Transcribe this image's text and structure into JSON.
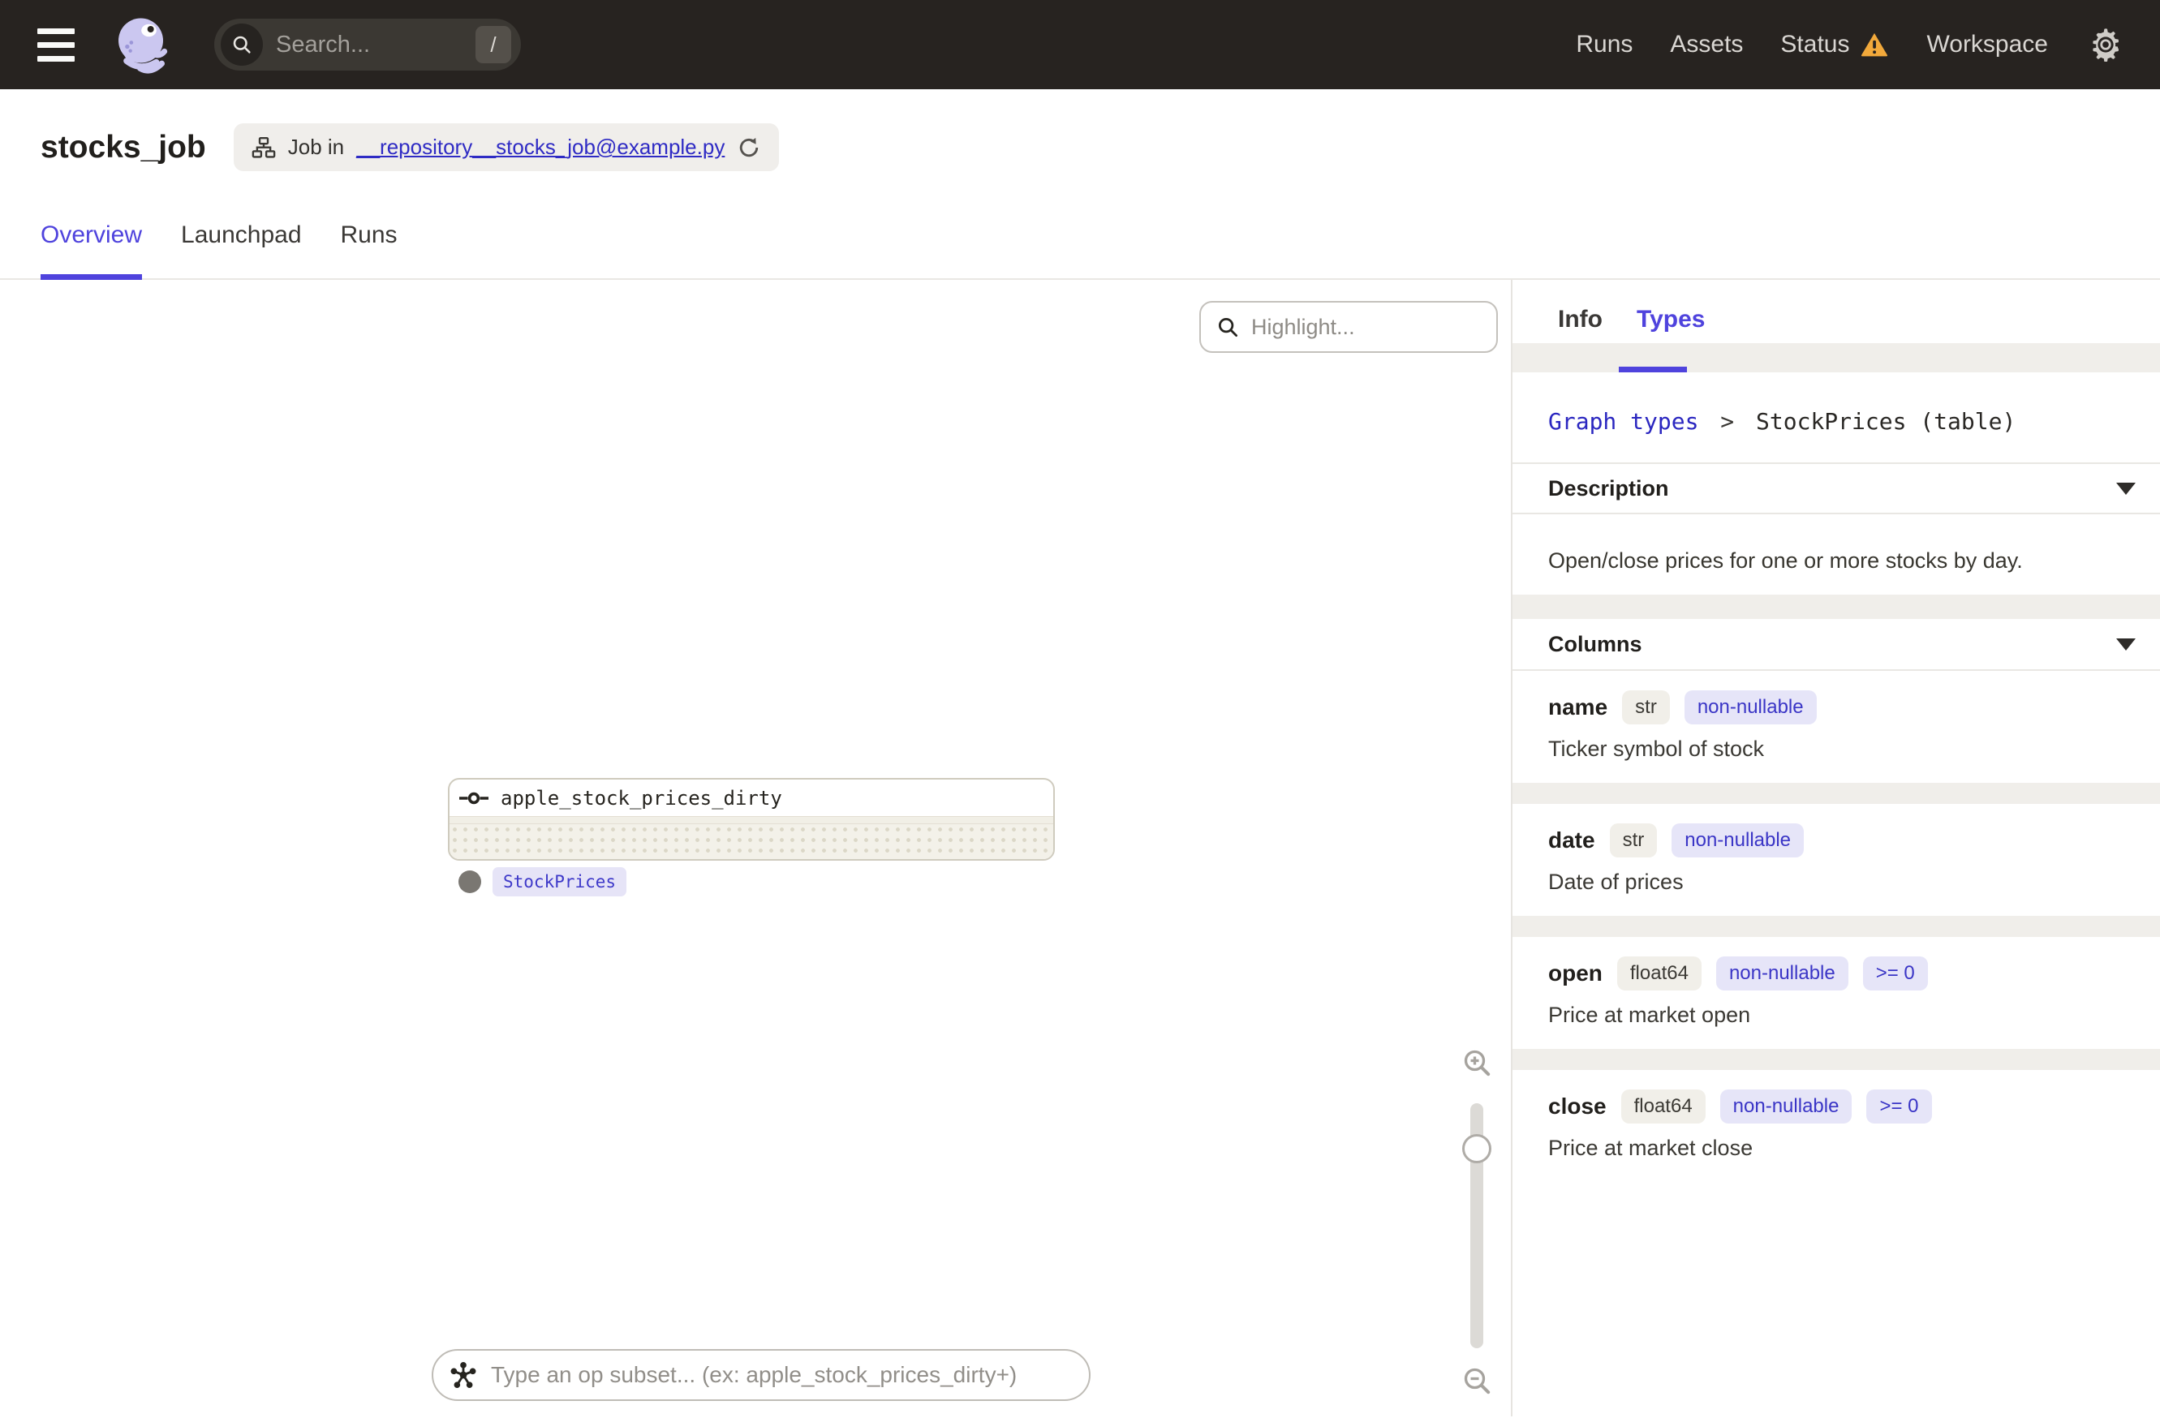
{
  "topbar": {
    "search": {
      "placeholder": "Search...",
      "shortcut": "/"
    },
    "nav": {
      "runs": "Runs",
      "assets": "Assets",
      "status": "Status",
      "workspace": "Workspace"
    }
  },
  "header": {
    "title": "stocks_job",
    "badge": {
      "prefix": "Job in",
      "link": "__repository__stocks_job@example.py"
    }
  },
  "tabs": {
    "overview": "Overview",
    "launchpad": "Launchpad",
    "runs": "Runs",
    "active": "Overview"
  },
  "canvas": {
    "highlight_placeholder": "Highlight...",
    "node": {
      "label": "apple_stock_prices_dirty",
      "output_type": "StockPrices"
    },
    "op_subset_placeholder": "Type an op subset... (ex: apple_stock_prices_dirty+)"
  },
  "panel": {
    "tabs": {
      "info": "Info",
      "types": "Types",
      "active": "Types"
    },
    "breadcrumb": {
      "link": "Graph types",
      "separator": ">",
      "current": "StockPrices (table)"
    },
    "description": {
      "title": "Description",
      "text": "Open/close prices for one or more stocks by day."
    },
    "columns": {
      "title": "Columns",
      "rows": [
        {
          "name": "name",
          "tags": [
            "str",
            "non-nullable"
          ],
          "desc": "Ticker symbol of stock"
        },
        {
          "name": "date",
          "tags": [
            "str",
            "non-nullable"
          ],
          "desc": "Date of prices"
        },
        {
          "name": "open",
          "tags": [
            "float64",
            "non-nullable",
            ">= 0"
          ],
          "desc": "Price at market open"
        },
        {
          "name": "close",
          "tags": [
            "float64",
            "non-nullable",
            ">= 0"
          ],
          "desc": "Price at market close"
        }
      ]
    }
  },
  "colors": {
    "accent": "#4F43DD",
    "link_blue": "#2B27C0",
    "warning": "#F2A93B",
    "topbar_bg": "#272320",
    "tag_purple_bg": "#E6E5F8",
    "tag_gray_bg": "#F1EFE9",
    "logo_lavender": "#CBC7F0"
  }
}
